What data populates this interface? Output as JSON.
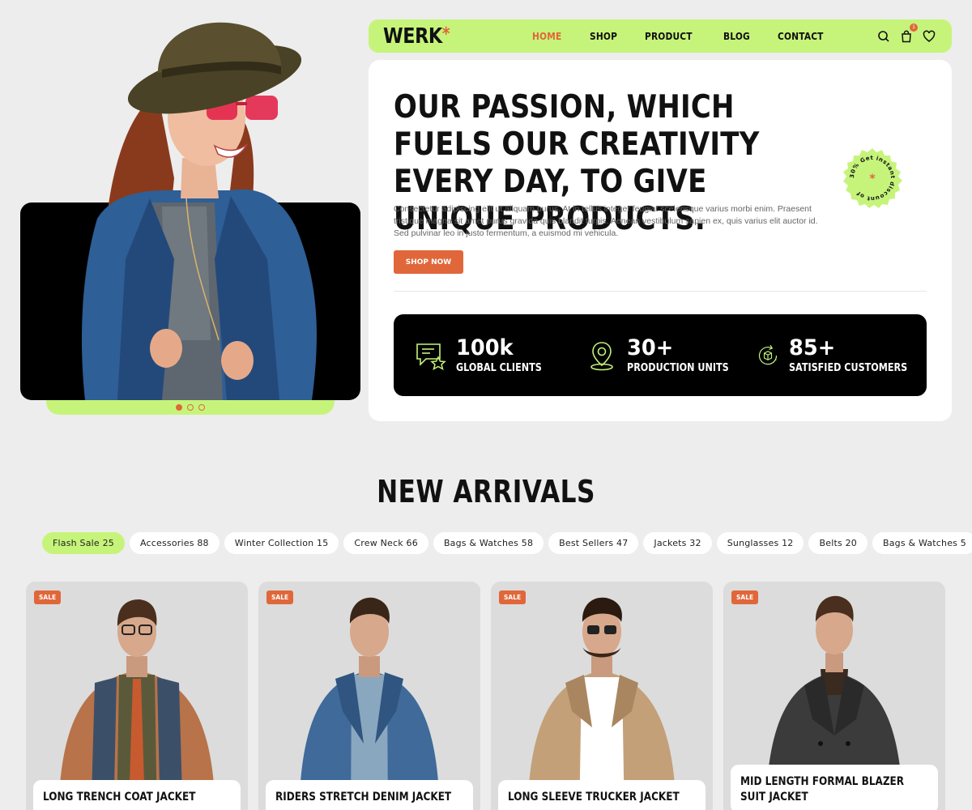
{
  "brand": {
    "name": "WERK",
    "mark": "*"
  },
  "nav": {
    "links": [
      "HOME",
      "SHOP",
      "PRODUCT",
      "BLOG",
      "CONTACT"
    ],
    "active_index": 0,
    "cart_count": "1"
  },
  "hero": {
    "title": "OUR PASSION, WHICH FUELS OUR CREATIVITY EVERY DAY, TO GIVE UNIQUE PRODUCTS.",
    "description": "Consectetur adipiscing elit ut aliquam purus. At in tellus integer feugiat scelerisque varius morbi enim. Praesent tristique magna sit amet purus gravida quis blandit turpis. Aenean vestibulum sapien ex, quis varius elit auctor id. Sed pulvinar leo in justo fermentum, a euismod mi vehicula.",
    "cta_label": "SHOP NOW",
    "seal_text": "30% Get instant discount of ",
    "slider_dots": 3,
    "active_dot": 0
  },
  "stats": [
    {
      "value": "100k",
      "label": "GLOBAL CLIENTS",
      "icon": "chat-star-icon"
    },
    {
      "value": "30+",
      "label": "PRODUCTION UNITS",
      "icon": "location-pin-icon"
    },
    {
      "value": "85+",
      "label": "SATISFIED CUSTOMERS",
      "icon": "box-refresh-icon"
    }
  ],
  "new_arrivals": {
    "title": "NEW ARRIVALS",
    "filters": [
      "Flash Sale 25",
      "Accessories 88",
      "Winter Collection 15",
      "Crew Neck 66",
      "Bags & Watches 58",
      "Best Sellers 47",
      "Jackets 32",
      "Sunglasses 12",
      "Belts 20",
      "Bags & Watches 5"
    ],
    "active_filter": 0,
    "products": [
      {
        "badge": "SALE",
        "name": "LONG TRENCH COAT JACKET",
        "jacket_color": "#b8734a",
        "shirt_color": "#5a5a3a"
      },
      {
        "badge": "SALE",
        "name": "RIDERS STRETCH DENIM JACKET",
        "jacket_color": "#3f6a9a",
        "shirt_color": "#8aa7c0"
      },
      {
        "badge": "SALE",
        "name": "LONG SLEEVE TRUCKER JACKET",
        "jacket_color": "#c4a078",
        "shirt_color": "#ffffff"
      },
      {
        "badge": "SALE",
        "name": "MID LENGTH FORMAL BLAZER\nSUIT JACKET",
        "jacket_color": "#3b3b3b",
        "shirt_color": "#3a2a20"
      }
    ]
  },
  "colors": {
    "accent": "#e0673a",
    "lime": "#c6f47a",
    "background": "#ededed"
  }
}
